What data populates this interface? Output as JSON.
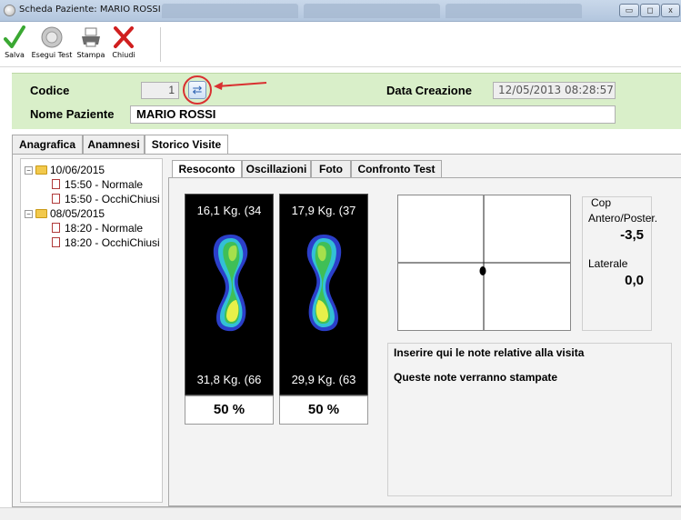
{
  "window": {
    "title": "Scheda Paziente: MARIO ROSSI",
    "minimize_glyph": "▭",
    "maximize_glyph": "◻",
    "close_glyph": "x"
  },
  "toolbar": {
    "buttons": [
      {
        "label": "Salva",
        "icon": "checkmark-icon",
        "color": "#3aa832"
      },
      {
        "label": "Esegui Test",
        "icon": "platform-icon",
        "color": "#9a9a9a"
      },
      {
        "label": "Stampa",
        "icon": "printer-icon",
        "color": "#6b6b6b"
      },
      {
        "label": "Chiudi",
        "icon": "close-x-icon",
        "color": "#d01f1f"
      }
    ]
  },
  "header": {
    "codice_label": "Codice",
    "codice_value": "1",
    "refresh_glyph": "⇄",
    "data_creazione_label": "Data Creazione",
    "data_creazione_value": "12/05/2013 08:28:57",
    "nome_label": "Nome Paziente",
    "nome_value": "MARIO ROSSI"
  },
  "tabs": [
    "Anagrafica",
    "Anamnesi",
    "Storico Visite"
  ],
  "active_tab": "Storico Visite",
  "tree": [
    {
      "date": "10/06/2015",
      "toggle": "−",
      "items": [
        "15:50 - Normale",
        "15:50 - OcchiChiusi"
      ]
    },
    {
      "date": "08/05/2015",
      "toggle": "−",
      "items": [
        "18:20 - Normale",
        "18:20 - OcchiChiusi"
      ]
    }
  ],
  "subtabs": [
    "Resoconto",
    "Oscillazioni",
    "Foto",
    "Confronto Test"
  ],
  "active_subtab": "Resoconto",
  "feet": {
    "left": {
      "top": "16,1 Kg. (34",
      "bottom": "31,8 Kg. (66",
      "percent": "50 %"
    },
    "right": {
      "top": "17,9 Kg. (37",
      "bottom": "29,9 Kg. (63",
      "percent": "50 %"
    }
  },
  "cop": {
    "title": "Cop",
    "antero_label": "Antero/Poster.",
    "antero_value": "-3,5",
    "laterale_label": "Laterale",
    "laterale_value": "0,0"
  },
  "notes": {
    "line1": "Inserire qui le note relative alla visita",
    "line2": "Queste note verranno stampate"
  },
  "colors": {
    "header_bg": "#d9efc9",
    "highlight": "#d93030"
  }
}
